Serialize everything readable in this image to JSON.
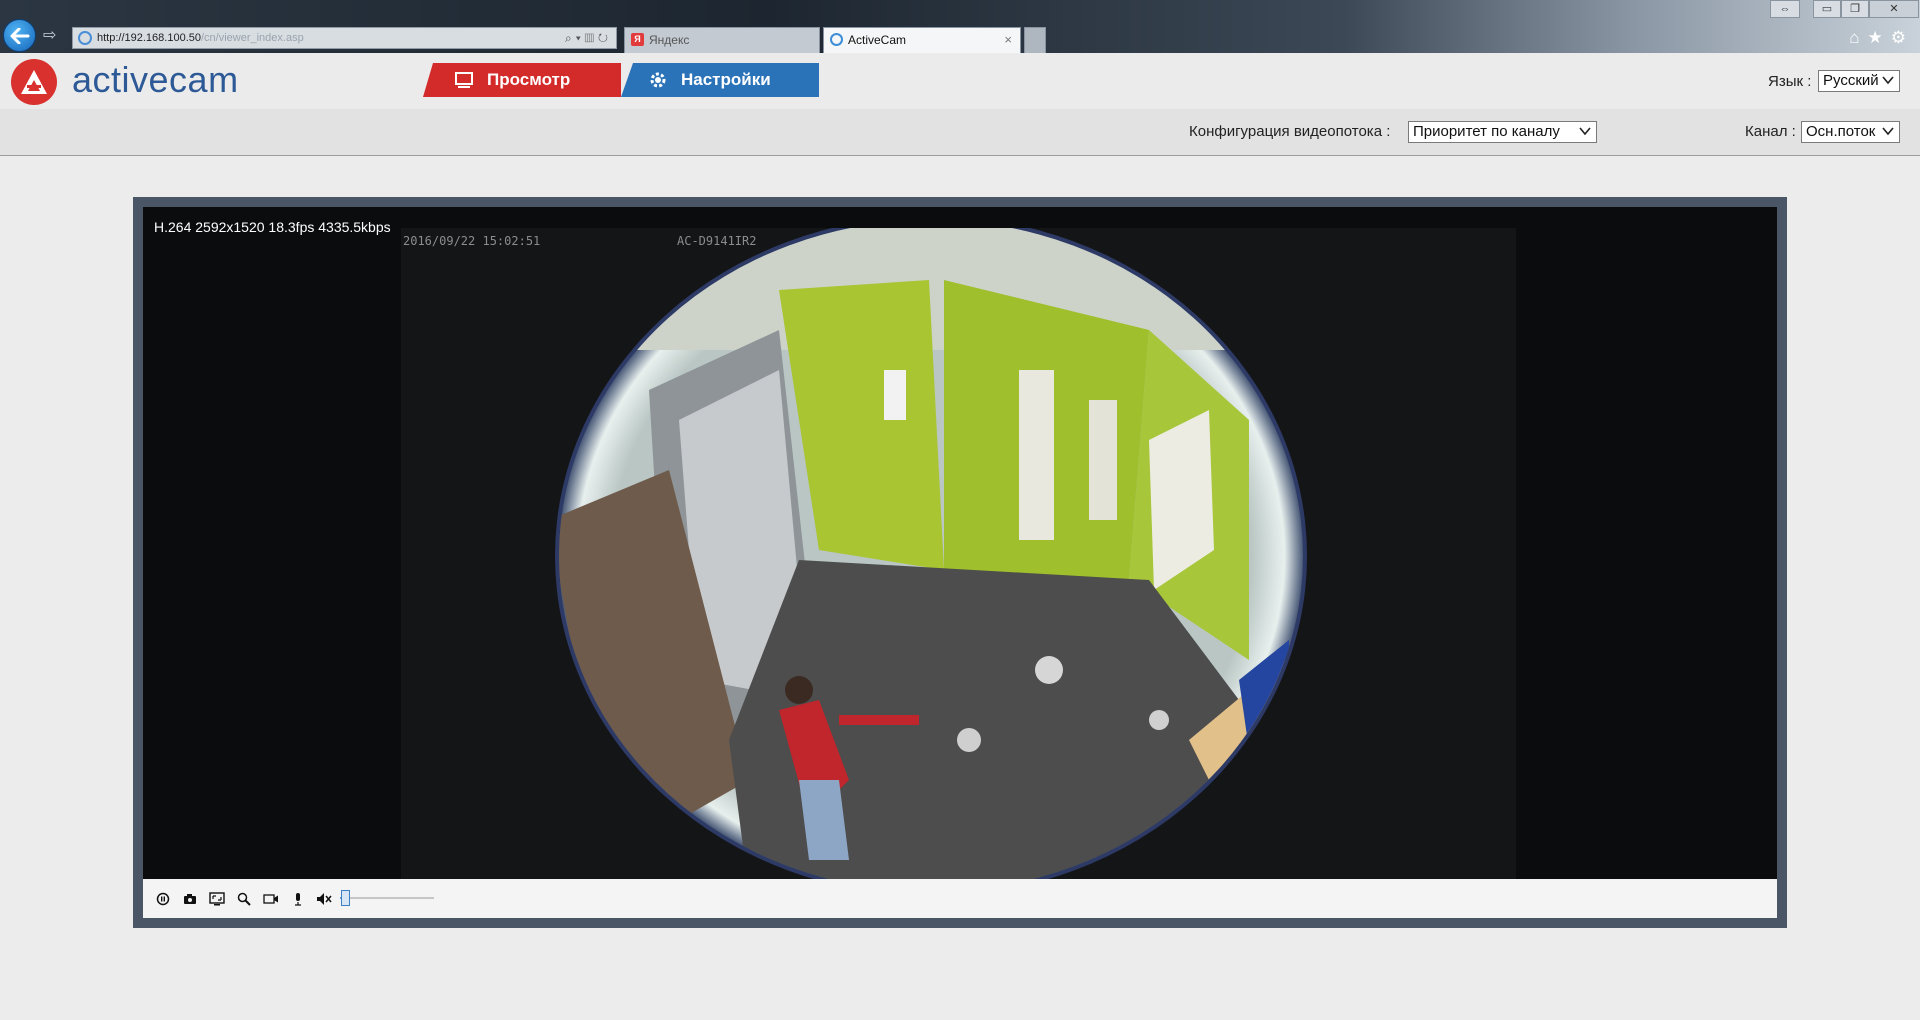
{
  "browser": {
    "url_host": "http://192.168.100.50",
    "url_path": "/cn/viewer_index.asp",
    "tabs": [
      {
        "title": "Яндекс",
        "favicon_letter": "Я"
      },
      {
        "title": "ActiveCam",
        "close": "×"
      }
    ]
  },
  "app": {
    "logo_text": "activecam",
    "nav": {
      "view_label": "Просмотр",
      "settings_label": "Настройки"
    },
    "language": {
      "label": "Язык :",
      "selected": "Русский"
    },
    "stream_config": {
      "label": "Конфигурация видеопотока :",
      "selected": "Приоритет по каналу"
    },
    "channel": {
      "label": "Канал :",
      "selected": "Осн.поток"
    }
  },
  "player": {
    "stream_info": "H.264 2592x1520 18.3fps 4335.5kbps",
    "osd_timestamp": "2016/09/22 15:02:51",
    "osd_camera": "AC-D9141IR2",
    "volume_level": 0.05,
    "controls": [
      "record-icon",
      "snapshot-icon",
      "fullscreen-icon",
      "zoom-icon",
      "video-record-icon",
      "microphone-icon",
      "mute-icon"
    ]
  },
  "colors": {
    "view_tab": "#d32a2a",
    "settings_tab": "#2a73b8",
    "logo": "#d8312e",
    "logo_text": "#2d5a96",
    "player_frame": "#4a5566"
  }
}
